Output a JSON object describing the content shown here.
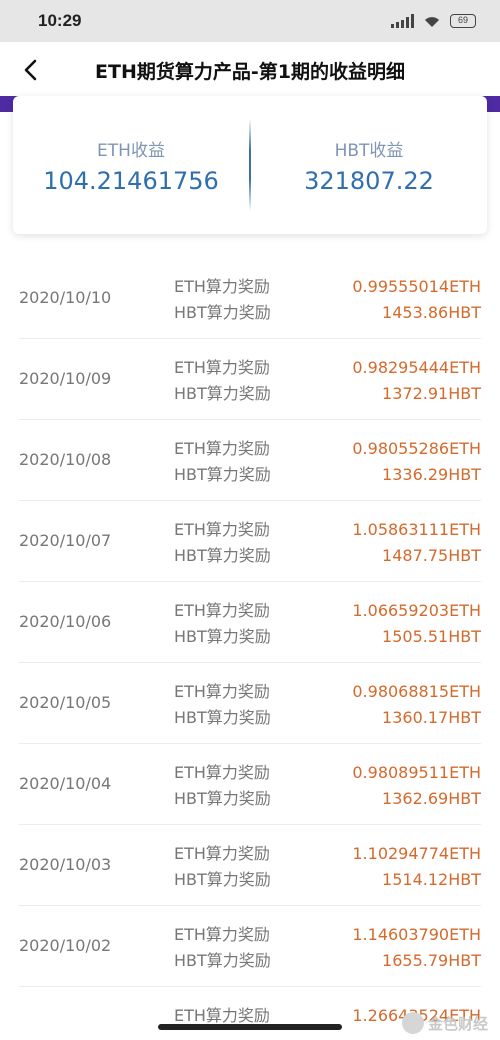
{
  "status": {
    "time": "10:29",
    "battery": "69"
  },
  "header": {
    "title": "ETH期货算力产品-第1期的收益明细"
  },
  "summary": {
    "eth": {
      "label": "ETH收益",
      "value": "104.21461756"
    },
    "hbt": {
      "label": "HBT收益",
      "value": "321807.22"
    }
  },
  "records": [
    {
      "date": "2020/10/10",
      "eth_label": "ETH算力奖励",
      "hbt_label": "HBT算力奖励",
      "eth_value": "0.99555014ETH",
      "hbt_value": "1453.86HBT"
    },
    {
      "date": "2020/10/09",
      "eth_label": "ETH算力奖励",
      "hbt_label": "HBT算力奖励",
      "eth_value": "0.98295444ETH",
      "hbt_value": "1372.91HBT"
    },
    {
      "date": "2020/10/08",
      "eth_label": "ETH算力奖励",
      "hbt_label": "HBT算力奖励",
      "eth_value": "0.98055286ETH",
      "hbt_value": "1336.29HBT"
    },
    {
      "date": "2020/10/07",
      "eth_label": "ETH算力奖励",
      "hbt_label": "HBT算力奖励",
      "eth_value": "1.05863111ETH",
      "hbt_value": "1487.75HBT"
    },
    {
      "date": "2020/10/06",
      "eth_label": "ETH算力奖励",
      "hbt_label": "HBT算力奖励",
      "eth_value": "1.06659203ETH",
      "hbt_value": "1505.51HBT"
    },
    {
      "date": "2020/10/05",
      "eth_label": "ETH算力奖励",
      "hbt_label": "HBT算力奖励",
      "eth_value": "0.98068815ETH",
      "hbt_value": "1360.17HBT"
    },
    {
      "date": "2020/10/04",
      "eth_label": "ETH算力奖励",
      "hbt_label": "HBT算力奖励",
      "eth_value": "0.98089511ETH",
      "hbt_value": "1362.69HBT"
    },
    {
      "date": "2020/10/03",
      "eth_label": "ETH算力奖励",
      "hbt_label": "HBT算力奖励",
      "eth_value": "1.10294774ETH",
      "hbt_value": "1514.12HBT"
    },
    {
      "date": "2020/10/02",
      "eth_label": "ETH算力奖励",
      "hbt_label": "HBT算力奖励",
      "eth_value": "1.14603790ETH",
      "hbt_value": "1655.79HBT"
    },
    {
      "date": "",
      "eth_label": "ETH算力奖励",
      "hbt_label": "",
      "eth_value": "1.26643524ETH",
      "hbt_value": ""
    }
  ],
  "watermark": {
    "text": "金色财经"
  },
  "colors": {
    "accent_purple": "#4f2aa3",
    "value_orange": "#d46a2c",
    "summary_blue": "#2f6fae"
  }
}
